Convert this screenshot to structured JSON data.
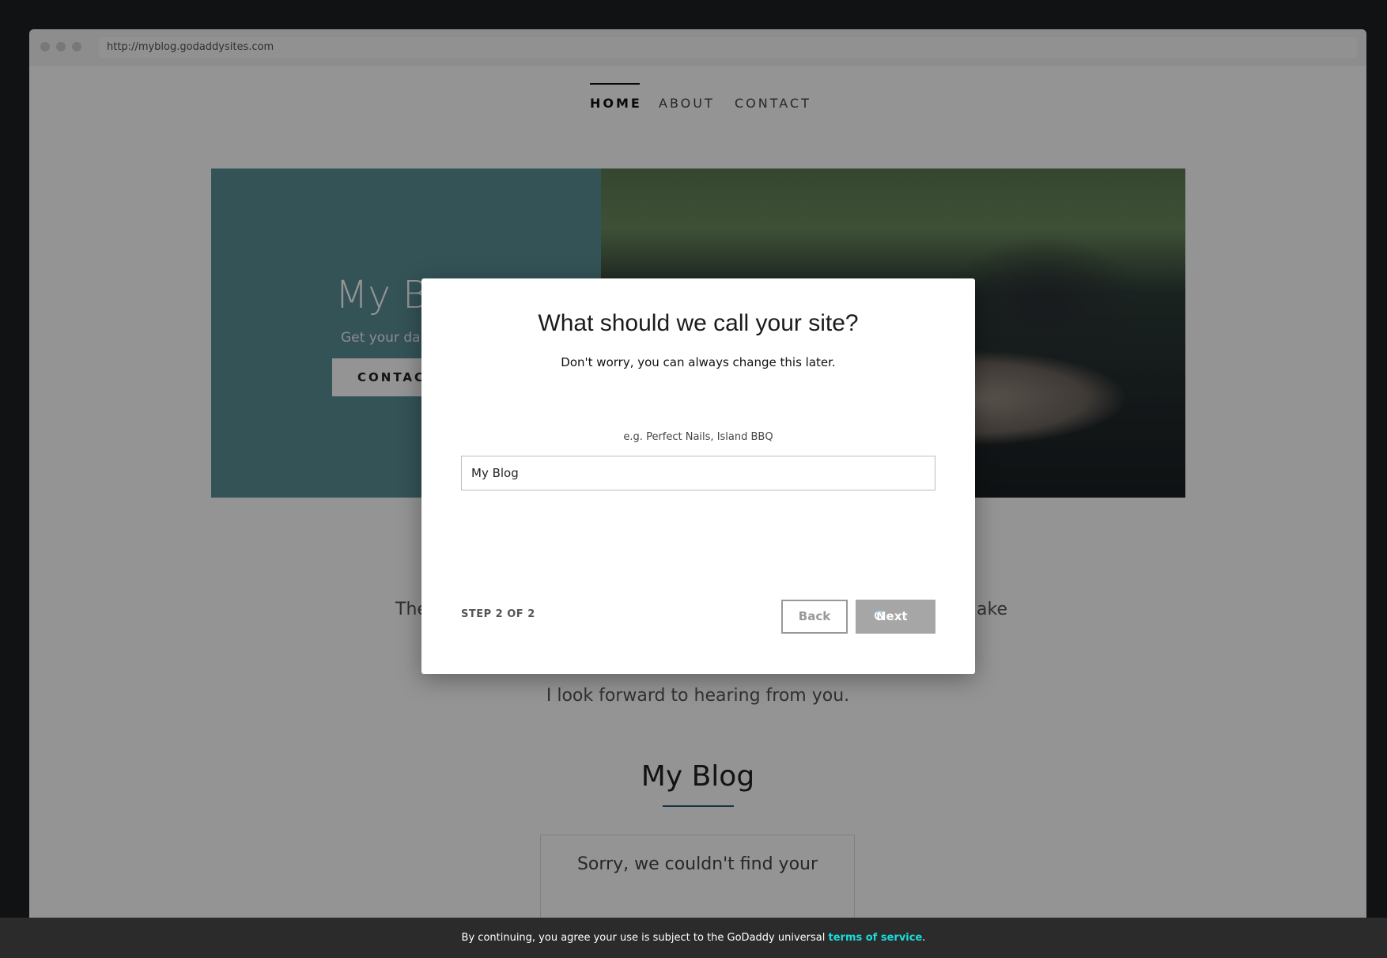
{
  "browser": {
    "url": "http://myblog.godaddysites.com"
  },
  "site": {
    "nav": [
      {
        "label": "HOME",
        "active": true
      },
      {
        "label": "ABOUT",
        "active": false
      },
      {
        "label": "CONTACT",
        "active": false
      }
    ],
    "hero": {
      "title": "My B",
      "subtitle": "Get your da",
      "button": "CONTACT"
    },
    "about": {
      "line1_left": "The",
      "line1_right": "ake",
      "line2": "I look forward to hearing from you."
    },
    "blog": {
      "title": "My Blog",
      "empty_message": "Sorry, we couldn't find your"
    }
  },
  "modal": {
    "title": "What should we call your site?",
    "subtitle": "Don't worry, you can always change this later.",
    "field_label": "e.g. Perfect Nails, Island BBQ",
    "field_value": "My Blog",
    "step": "STEP 2 OF 2",
    "back_label": "Back",
    "next_label": "Next"
  },
  "footer": {
    "text": "By continuing, you agree your use is subject to the GoDaddy universal",
    "link": "terms of service",
    "suffix": "."
  },
  "colors": {
    "accent": "#1bdbdb",
    "hero_panel": "#5a8f96",
    "next_button": "#a6a6a6"
  }
}
